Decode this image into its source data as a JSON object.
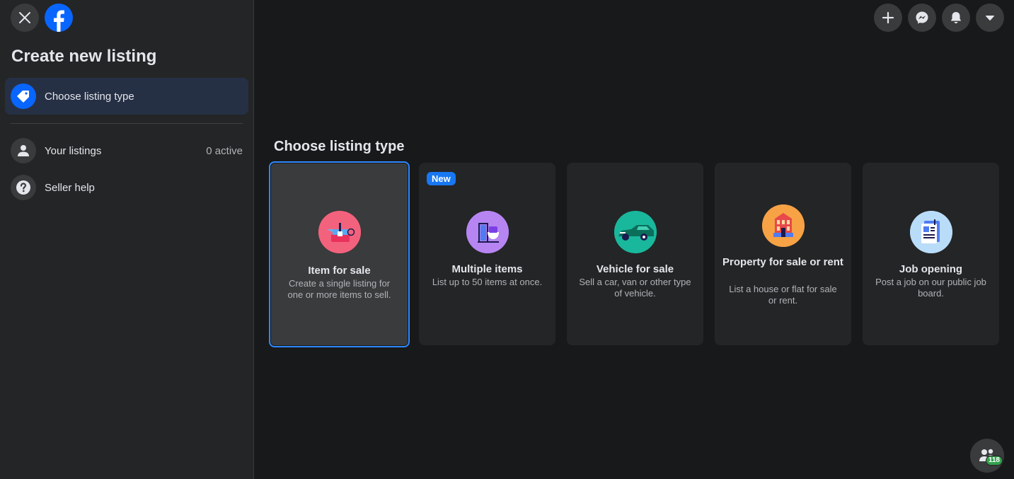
{
  "sidebar": {
    "title": "Create new listing",
    "active_item": {
      "label": "Choose listing type",
      "icon": "tag-icon"
    },
    "items": [
      {
        "label": "Your listings",
        "meta": "0 active",
        "icon": "person-icon"
      },
      {
        "label": "Seller help",
        "icon": "question-icon"
      }
    ]
  },
  "topbar": {
    "buttons": [
      "plus-icon",
      "messenger-icon",
      "bell-icon",
      "caret-down-icon"
    ]
  },
  "main": {
    "title": "Choose listing type",
    "cards": [
      {
        "title": "Item for sale",
        "desc": "Create a single listing for one or more items to sell.",
        "icon": "kettle-icon",
        "color": "#f3627d",
        "selected": true
      },
      {
        "title": "Multiple items",
        "desc": "List up to 50 items at once.",
        "icon": "teapot-cup-icon",
        "color": "#b685f2",
        "badge": "New"
      },
      {
        "title": "Vehicle for sale",
        "desc": "Sell a car, van or other type of vehicle.",
        "icon": "car-icon",
        "color": "#19b89c"
      },
      {
        "title": "Property for sale or rent",
        "desc": "List a house or flat for sale or rent.",
        "icon": "building-icon",
        "color": "#f7a245"
      },
      {
        "title": "Job opening",
        "desc": "Post a job on our public job board.",
        "icon": "clipboard-icon",
        "color": "#b9dcf9"
      }
    ]
  },
  "contacts": {
    "badge": "118"
  },
  "colors": {
    "accent": "#0866ff",
    "background": "#18191a",
    "surface": "#242526"
  }
}
